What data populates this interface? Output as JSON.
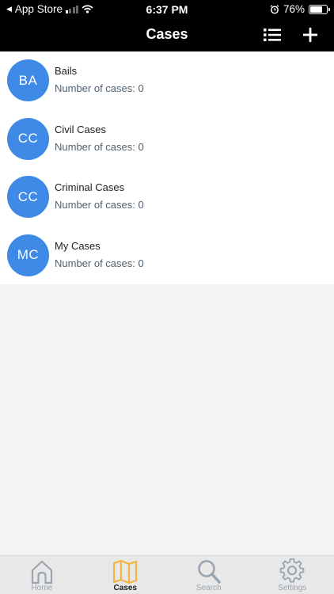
{
  "status_bar": {
    "back_label": "App Store",
    "time": "6:37 PM",
    "battery": "76%",
    "battery_level": 0.76
  },
  "nav": {
    "title": "Cases",
    "list_icon": "list-icon",
    "add_icon": "plus-icon"
  },
  "cases": [
    {
      "initials": "BA",
      "name": "Bails",
      "count_text": "Number of cases: 0"
    },
    {
      "initials": "CC",
      "name": "Civil Cases",
      "count_text": "Number of cases: 0"
    },
    {
      "initials": "CC",
      "name": "Criminal Cases",
      "count_text": "Number of cases: 0"
    },
    {
      "initials": "MC",
      "name": "My Cases",
      "count_text": "Number of cases: 0"
    }
  ],
  "tabs": [
    {
      "label": "Home",
      "icon": "home-icon",
      "active": false
    },
    {
      "label": "Cases",
      "icon": "map-icon",
      "active": true
    },
    {
      "label": "Search",
      "icon": "search-icon",
      "active": false
    },
    {
      "label": "Settings",
      "icon": "gear-icon",
      "active": false
    }
  ],
  "colors": {
    "avatar": "#3e8ae6",
    "active_tab_icon": "#f2b540",
    "inactive_tab_icon": "#9aa5b0"
  }
}
